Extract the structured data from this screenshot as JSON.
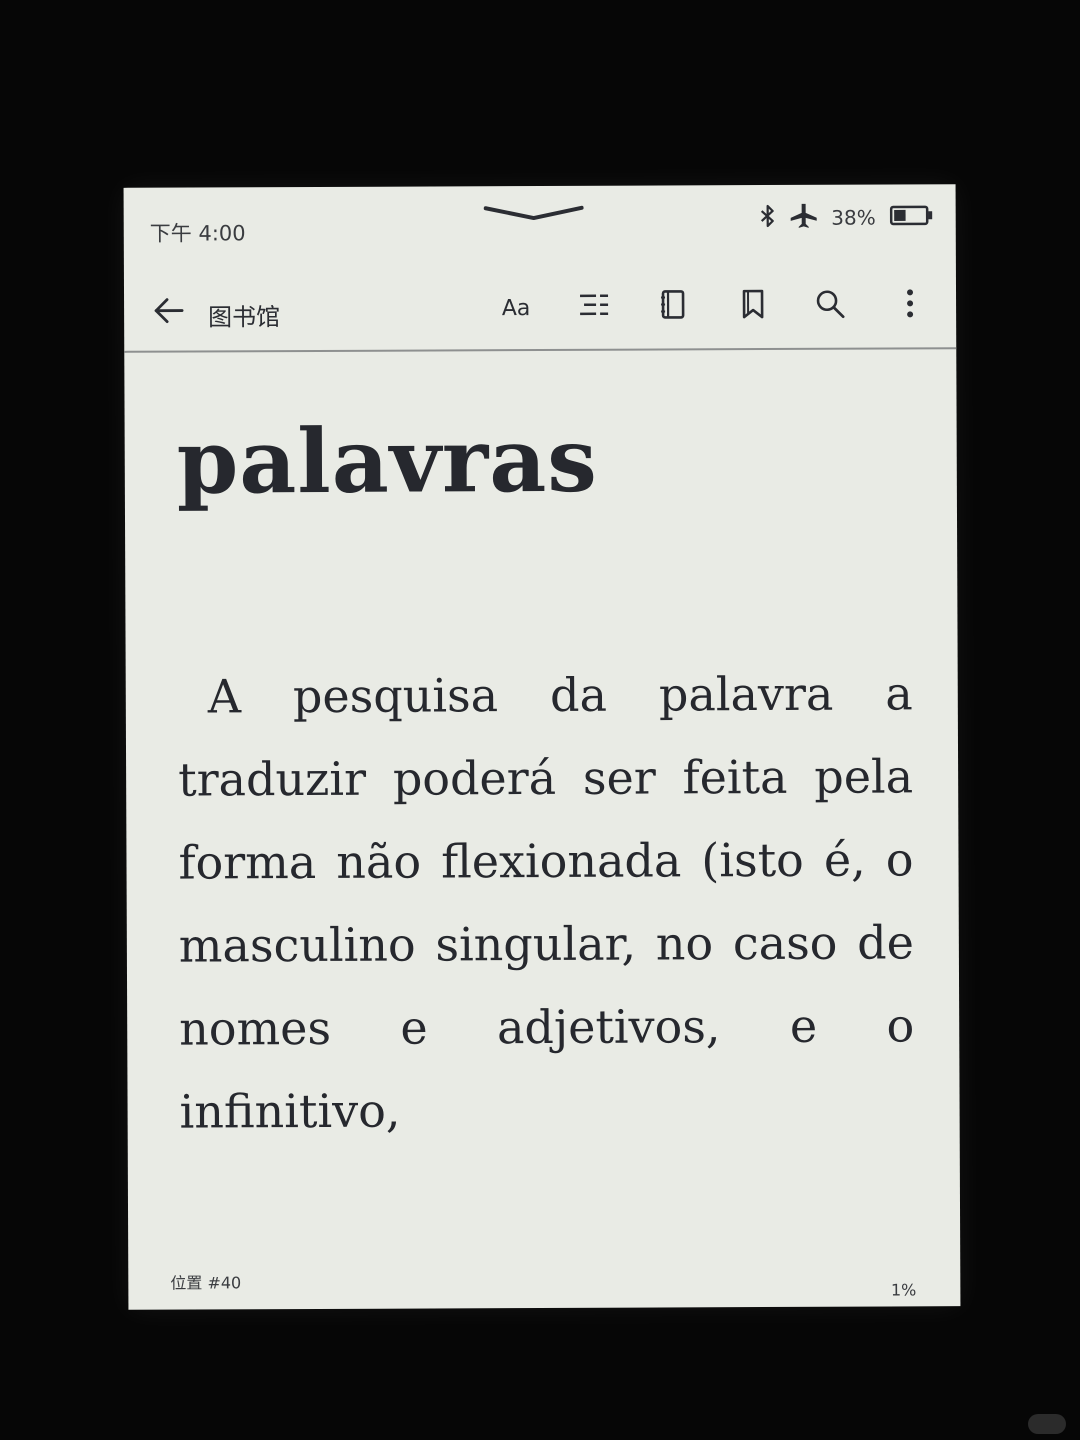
{
  "status_bar": {
    "time": "下午 4:00",
    "battery_percent": "38%",
    "battery_level": 0.38,
    "icons": [
      "bluetooth-icon",
      "airplane-mode-icon",
      "battery-icon"
    ]
  },
  "toolbar": {
    "back_icon": "arrow-left-icon",
    "library_label": "图书馆",
    "font_settings_label": "Aa",
    "icons": [
      "contents-icon",
      "notebook-icon",
      "bookmark-icon",
      "search-icon",
      "more-vertical-icon"
    ]
  },
  "book": {
    "heading": "palavras",
    "paragraph": "A pesquisa da palavra a traduzir poderá ser feita pela forma não flexionada (isto é, o masculino singular, no caso de nomes e adjetivos, e o infinitivo,"
  },
  "footer": {
    "location": "位置 #40",
    "progress": "1%"
  },
  "colors": {
    "screen": "#e9ebe5",
    "text": "#26282e",
    "background": "#060606"
  }
}
